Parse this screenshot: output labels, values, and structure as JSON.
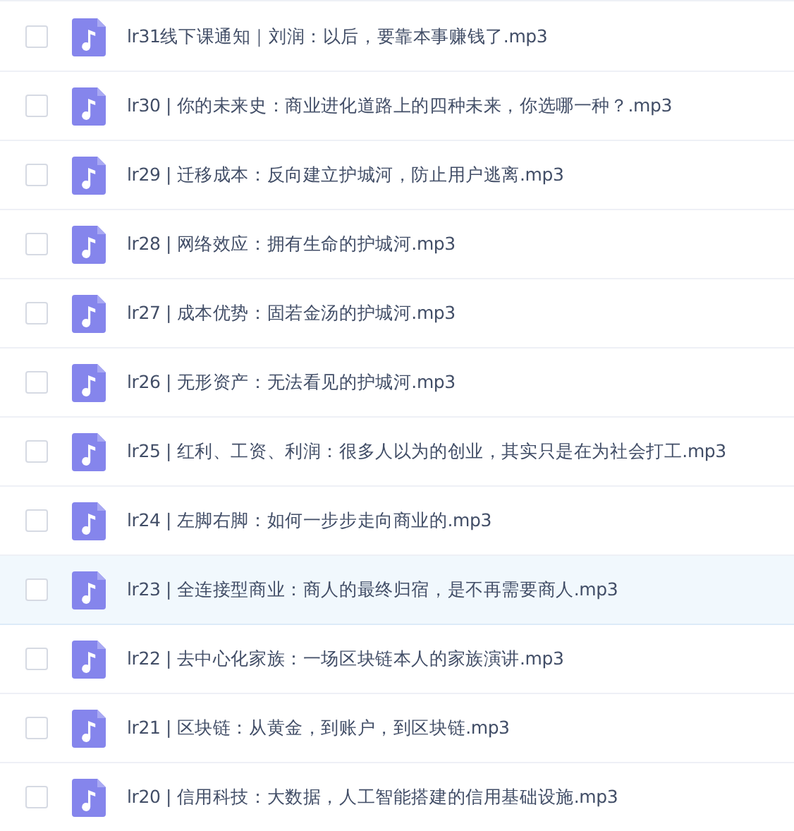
{
  "files": [
    {
      "name": "lr31线下课通知｜刘润：以后，要靠本事赚钱了.mp3",
      "checked": false,
      "highlighted": false
    },
    {
      "name": "lr30 | 你的未来史：商业进化道路上的四种未来，你选哪一种？.mp3",
      "checked": false,
      "highlighted": false
    },
    {
      "name": "lr29 | 迁移成本：反向建立护城河，防止用户逃离.mp3",
      "checked": false,
      "highlighted": false
    },
    {
      "name": "lr28 | 网络效应：拥有生命的护城河.mp3",
      "checked": false,
      "highlighted": false
    },
    {
      "name": "lr27 | 成本优势：固若金汤的护城河.mp3",
      "checked": false,
      "highlighted": false
    },
    {
      "name": "lr26 | 无形资产：无法看见的护城河.mp3",
      "checked": false,
      "highlighted": false
    },
    {
      "name": "lr25 | 红利、工资、利润：很多人以为的创业，其实只是在为社会打工.mp3",
      "checked": false,
      "highlighted": false
    },
    {
      "name": "lr24 | 左脚右脚：如何一步步走向商业的.mp3",
      "checked": false,
      "highlighted": false
    },
    {
      "name": "lr23 | 全连接型商业：商人的最终归宿，是不再需要商人.mp3",
      "checked": false,
      "highlighted": true
    },
    {
      "name": "lr22 | 去中心化家族：一场区块链本人的家族演讲.mp3",
      "checked": false,
      "highlighted": false
    },
    {
      "name": "lr21 | 区块链：从黄金，到账户，到区块链.mp3",
      "checked": false,
      "highlighted": false
    },
    {
      "name": "lr20 | 信用科技：大数据，人工智能搭建的信用基础设施.mp3",
      "checked": false,
      "highlighted": false
    }
  ]
}
